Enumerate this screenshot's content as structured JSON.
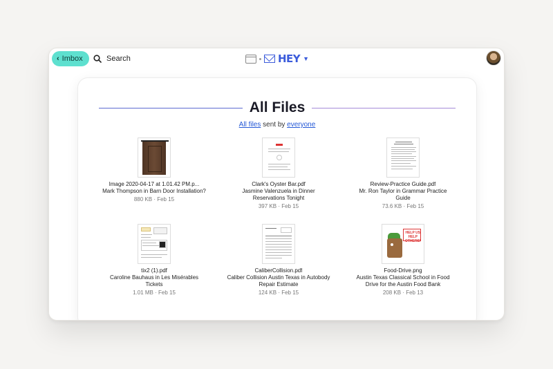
{
  "topbar": {
    "back_label": "Imbox",
    "search_label": "Search",
    "brand": "HEY"
  },
  "page": {
    "title": "All Files",
    "subtitle_link1": "All files",
    "subtitle_mid": " sent by ",
    "subtitle_link2": "everyone"
  },
  "files": [
    {
      "name": "Image 2020-04-17 at 1.01.42 PM.p...",
      "desc": "Mark Thompson in Barn Door Installation?",
      "meta": "880 KB · Feb 15",
      "thumb": "door-image"
    },
    {
      "name": "Clark's Oyster Bar.pdf",
      "desc": "Jasmine Valenzuela in Dinner Reservations Tonight",
      "meta": "397 KB · Feb 15",
      "thumb": "document"
    },
    {
      "name": "Review-Practice Guide.pdf",
      "desc": "Mr. Ron Taylor in Grammar Practice Guide",
      "meta": "73.6 KB · Feb 15",
      "thumb": "document"
    },
    {
      "name": "tix2 (1).pdf",
      "desc": "Caroline Bauhaus in Les Misérables Tickets",
      "meta": "1.01 MB · Feb 15",
      "thumb": "ticket"
    },
    {
      "name": "CaliberCollision.pdf",
      "desc": "Caliber Collision Austin Texas in Autobody Repair Estimate",
      "meta": "124 KB · Feb 15",
      "thumb": "estimate"
    },
    {
      "name": "Food-Drive.png",
      "desc": "Austin Texas Classical School in Food Drive for the Austin Food Bank",
      "meta": "208 KB · Feb 13",
      "thumb": "food-drive",
      "sign_text": "HELP US HELP OTHERS!"
    }
  ],
  "colors": {
    "accent": "#5ee0cf",
    "link": "#2357d6",
    "brand": "#3b5bdb"
  }
}
